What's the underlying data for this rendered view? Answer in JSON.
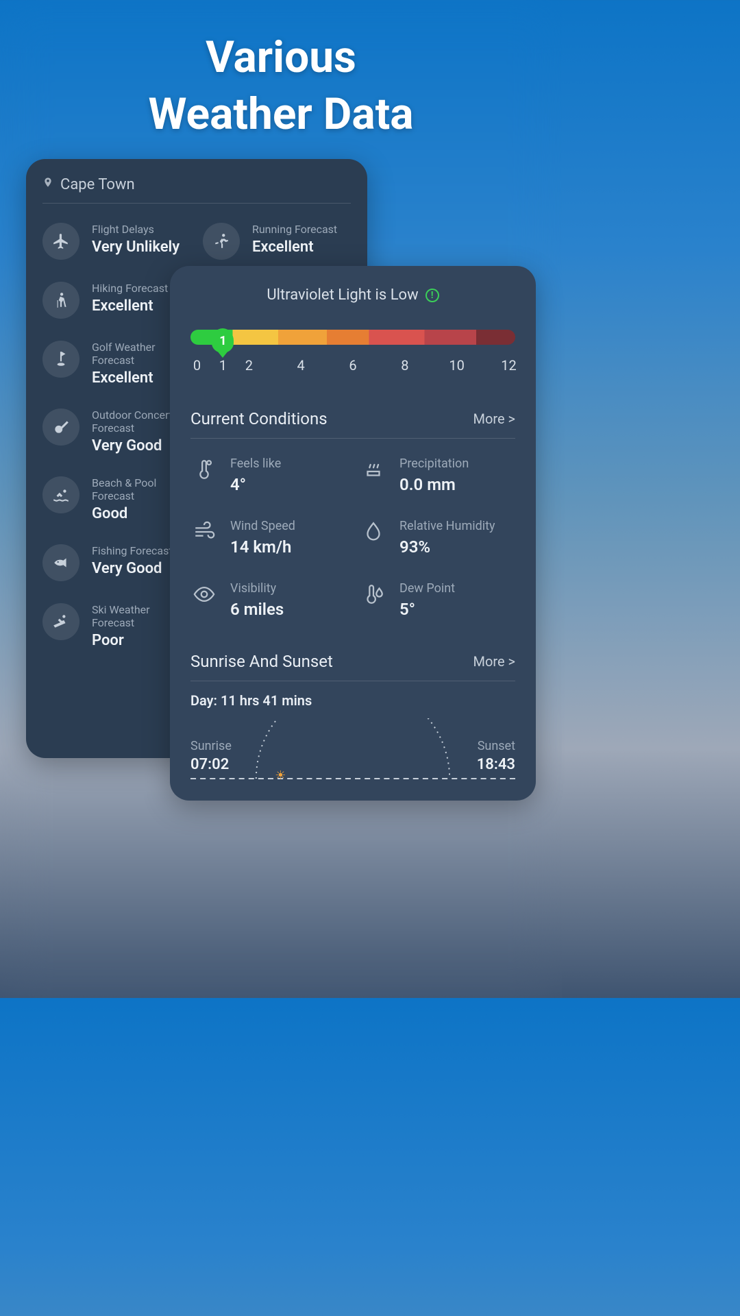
{
  "hero": {
    "line1": "Various",
    "line2": "Weather Data"
  },
  "location": "Cape Town",
  "activities": [
    {
      "label": "Flight Delays",
      "value": "Very Unlikely",
      "icon": "airplane"
    },
    {
      "label": "Running Forecast",
      "value": "Excellent",
      "icon": "running"
    },
    {
      "label": "Hiking Forecast",
      "value": "Excellent",
      "icon": "hiking"
    },
    {
      "label": "",
      "value": "",
      "icon": ""
    },
    {
      "label": "Golf Weather Forecast",
      "value": "Excellent",
      "icon": "golf"
    },
    {
      "label": "",
      "value": "",
      "icon": ""
    },
    {
      "label": "Outdoor Concert Forecast",
      "value": "Very Good",
      "icon": "guitar"
    },
    {
      "label": "",
      "value": "",
      "icon": ""
    },
    {
      "label": "Beach & Pool Forecast",
      "value": "Good",
      "icon": "swim"
    },
    {
      "label": "",
      "value": "",
      "icon": ""
    },
    {
      "label": "Fishing Forecast",
      "value": "Very Good",
      "icon": "fish"
    },
    {
      "label": "",
      "value": "",
      "icon": ""
    },
    {
      "label": "Ski Weather Forecast",
      "value": "Poor",
      "icon": "ski"
    }
  ],
  "uv": {
    "title": "Ultraviolet Light is Low",
    "value": "1",
    "ticks": [
      "0",
      "1",
      "2",
      "4",
      "6",
      "8",
      "10",
      "12"
    ],
    "tickPositions": [
      2,
      10,
      18,
      34,
      50,
      66,
      82,
      98
    ]
  },
  "conditions": {
    "title": "Current Conditions",
    "more": "More >",
    "items": [
      {
        "label": "Feels like",
        "value": "4°",
        "icon": "thermometer"
      },
      {
        "label": "Precipitation",
        "value": "0.0 mm",
        "icon": "precipitation"
      },
      {
        "label": "Wind Speed",
        "value": "14 km/h",
        "icon": "wind"
      },
      {
        "label": "Relative Humidity",
        "value": "93%",
        "icon": "humidity"
      },
      {
        "label": "Visibility",
        "value": "6 miles",
        "icon": "visibility"
      },
      {
        "label": "Dew Point",
        "value": "5°",
        "icon": "dewpoint"
      }
    ]
  },
  "sun": {
    "title": "Sunrise And Sunset",
    "more": "More >",
    "dayLength": "Day: 11 hrs 41 mins",
    "sunriseLabel": "Sunrise",
    "sunriseValue": "07:02",
    "sunsetLabel": "Sunset",
    "sunsetValue": "18:43"
  }
}
